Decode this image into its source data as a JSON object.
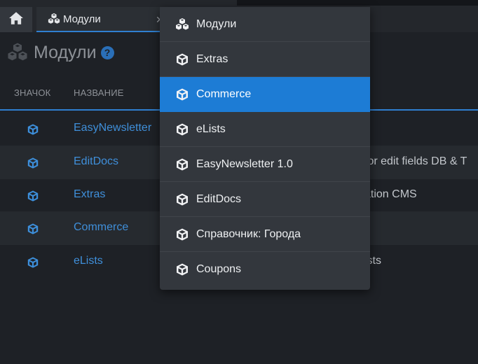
{
  "tabs": [
    {
      "icon": "home-icon"
    },
    {
      "icon": "cubes-icon",
      "label": "Модули",
      "close": "✕"
    }
  ],
  "page": {
    "title": "Модули",
    "title_icon": "cubes-icon",
    "help": "?"
  },
  "table": {
    "headers": [
      "ЗНАЧОК",
      "НАЗВАНИЕ"
    ],
    "rows": [
      {
        "icon": "cube-icon",
        "name": "EasyNewsletter",
        "desc": ""
      },
      {
        "icon": "cube-icon",
        "name": "EditDocs",
        "desc": "for edit fields DB & T"
      },
      {
        "icon": "cube-icon",
        "name": "Extras",
        "desc": "ation CMS"
      },
      {
        "icon": "cube-icon",
        "name": "Commerce",
        "desc": ""
      },
      {
        "icon": "cube-icon",
        "name": "eLists",
        "desc": "ists"
      }
    ]
  },
  "dropdown": {
    "active_index": 2,
    "items": [
      {
        "icon": "cubes-icon",
        "label": "Модули"
      },
      {
        "icon": "cube-icon",
        "label": "Extras"
      },
      {
        "icon": "cube-icon",
        "label": "Commerce"
      },
      {
        "icon": "cube-icon",
        "label": "eLists"
      },
      {
        "icon": "cube-icon",
        "label": "EasyNewsletter 1.0"
      },
      {
        "icon": "cube-icon",
        "label": "EditDocs"
      },
      {
        "icon": "cube-icon",
        "label": "Справочник: Города"
      },
      {
        "icon": "cube-icon",
        "label": "Coupons"
      }
    ]
  },
  "colors": {
    "accent": "#1d7cd5",
    "link": "#3f8fda",
    "background": "#1e2126",
    "dropdown_bg": "#33373d"
  }
}
